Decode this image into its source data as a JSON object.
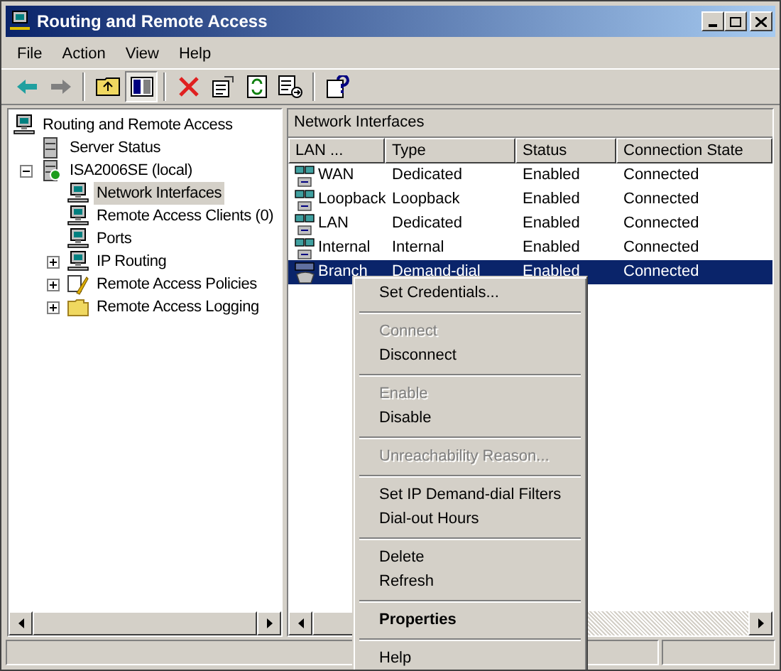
{
  "window": {
    "title": "Routing and Remote Access"
  },
  "menu": [
    {
      "label": "File"
    },
    {
      "label": "Action"
    },
    {
      "label": "View"
    },
    {
      "label": "Help"
    }
  ],
  "tree": [
    {
      "label": "Routing and Remote Access",
      "kind": "computer",
      "selected": false,
      "children": [
        {
          "label": "Server Status",
          "kind": "server",
          "selected": false
        },
        {
          "label": "ISA2006SE (local)",
          "kind": "server-on",
          "selected": false,
          "expanded": true,
          "children": [
            {
              "label": "Network Interfaces",
              "kind": "computer",
              "selected": true
            },
            {
              "label": "Remote Access Clients (0)",
              "kind": "computer",
              "selected": false
            },
            {
              "label": "Ports",
              "kind": "computer",
              "selected": false
            },
            {
              "label": "IP Routing",
              "kind": "computer",
              "selected": false,
              "expanded": false
            },
            {
              "label": "Remote Access Policies",
              "kind": "policy",
              "selected": false,
              "expanded": false
            },
            {
              "label": "Remote Access Logging",
              "kind": "folder",
              "selected": false,
              "expanded": false
            }
          ]
        }
      ]
    }
  ],
  "details": {
    "title": "Network Interfaces",
    "columns": [
      "LAN ...",
      "Type",
      "Status",
      "Connection State"
    ],
    "rows": [
      {
        "cells": [
          "WAN",
          "Dedicated",
          "Enabled",
          "Connected"
        ],
        "kind": "lan",
        "selected": false
      },
      {
        "cells": [
          "Loopback",
          "Loopback",
          "Enabled",
          "Connected"
        ],
        "kind": "lan",
        "selected": false
      },
      {
        "cells": [
          "LAN",
          "Dedicated",
          "Enabled",
          "Connected"
        ],
        "kind": "lan",
        "selected": false
      },
      {
        "cells": [
          "Internal",
          "Internal",
          "Enabled",
          "Connected"
        ],
        "kind": "lan",
        "selected": false
      },
      {
        "cells": [
          "Branch",
          "Demand-dial",
          "Enabled",
          "Connected"
        ],
        "kind": "dial",
        "selected": true
      }
    ]
  },
  "context_menu": [
    {
      "kind": "item",
      "label": "Set Credentials...",
      "disabled": false,
      "default": false
    },
    {
      "kind": "separator"
    },
    {
      "kind": "item",
      "label": "Connect",
      "disabled": true,
      "default": false
    },
    {
      "kind": "item",
      "label": "Disconnect",
      "disabled": false,
      "default": false
    },
    {
      "kind": "separator"
    },
    {
      "kind": "item",
      "label": "Enable",
      "disabled": true,
      "default": false
    },
    {
      "kind": "item",
      "label": "Disable",
      "disabled": false,
      "default": false
    },
    {
      "kind": "separator"
    },
    {
      "kind": "item",
      "label": "Unreachability Reason...",
      "disabled": true,
      "default": false
    },
    {
      "kind": "separator"
    },
    {
      "kind": "item",
      "label": "Set IP Demand-dial Filters",
      "disabled": false,
      "default": false
    },
    {
      "kind": "item",
      "label": "Dial-out Hours",
      "disabled": false,
      "default": false
    },
    {
      "kind": "separator"
    },
    {
      "kind": "item",
      "label": "Delete",
      "disabled": false,
      "default": false
    },
    {
      "kind": "item",
      "label": "Refresh",
      "disabled": false,
      "default": false
    },
    {
      "kind": "separator"
    },
    {
      "kind": "item",
      "label": "Properties",
      "disabled": false,
      "default": true
    },
    {
      "kind": "separator"
    },
    {
      "kind": "item",
      "label": "Help",
      "disabled": false,
      "default": false
    }
  ]
}
